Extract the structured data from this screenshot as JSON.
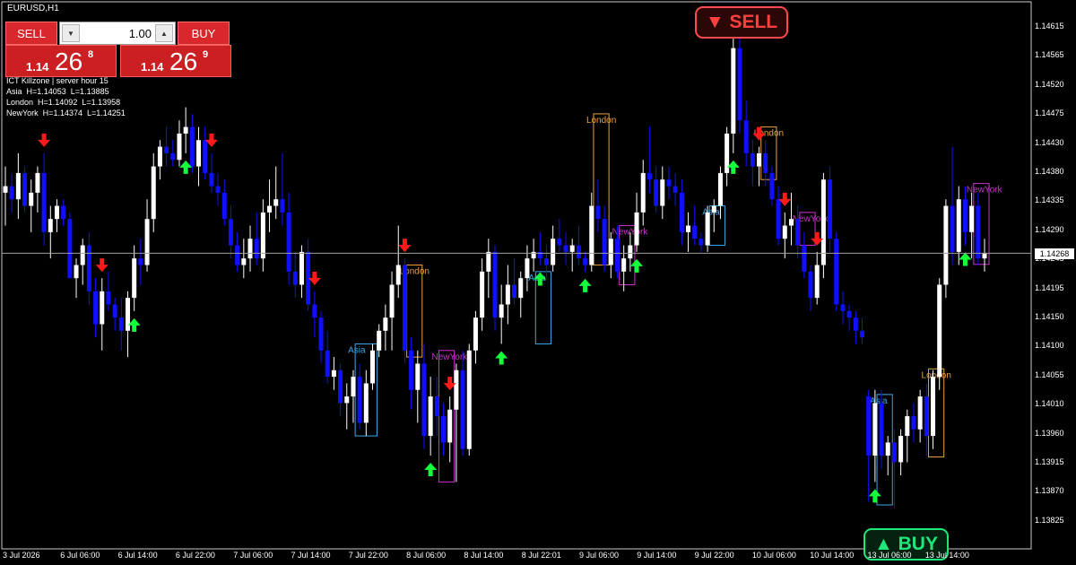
{
  "window": {
    "symbol_label": "EURUSD,H1"
  },
  "trade_panel": {
    "sell_label": "SELL",
    "buy_label": "BUY",
    "lot_value": "1.00",
    "sell_quote": {
      "prefix": "1.14",
      "big": "26",
      "sup": "8"
    },
    "buy_quote": {
      "prefix": "1.14",
      "big": "26",
      "sup": "9"
    }
  },
  "killzone_info": {
    "line1": "ICT Killzone | server hour 15",
    "line2": "Asia  H=1.14053  L=1.13885",
    "line3": "London  H=1.14092  L=1.13958",
    "line4": "NewYork  H=1.14374  L=1.14251"
  },
  "signals": {
    "sell_label": "▼ SELL",
    "buy_label": "▲ BUY"
  },
  "price_axis": {
    "labels": [
      "1.14615",
      "1.14565",
      "1.14520",
      "1.14475",
      "1.14430",
      "1.14380",
      "1.14335",
      "1.14290",
      "1.14245",
      "1.14195",
      "1.14150",
      "1.14100",
      "1.14055",
      "1.14010",
      "1.13960",
      "1.13915",
      "1.13870",
      "1.13825"
    ],
    "current_price": "1.14268"
  },
  "time_axis": {
    "labels": [
      "3 Jul 2026",
      "6 Jul 06:00",
      "6 Jul 14:00",
      "6 Jul 22:00",
      "7 Jul 06:00",
      "7 Jul 14:00",
      "7 Jul 22:00",
      "8 Jul 06:00",
      "8 Jul 14:00",
      "8 Jul 22:01",
      "9 Jul 06:00",
      "9 Jul 14:00",
      "9 Jul 22:00",
      "10 Jul 06:00",
      "10 Jul 14:00",
      "13 Jul 06:00",
      "13 Jul 14:00"
    ]
  },
  "colors": {
    "bull": "#ffffff",
    "bear": "#1010ff",
    "sell_arrow": "#ff1a1a",
    "buy_arrow": "#14ff3c",
    "asia": "#3aa7e8",
    "london": "#e8a040",
    "newyork": "#cc33cc"
  },
  "session_labels": {
    "asia": "Asia",
    "london": "London",
    "newyork": "NewYork"
  },
  "chart_data": {
    "type": "candlestick",
    "symbol": "EURUSD",
    "timeframe": "H1",
    "ylim": [
      1.13825,
      1.14615
    ],
    "current_price": 1.14268,
    "candles": [
      {
        "o": 1.1436,
        "h": 1.144,
        "l": 1.1431,
        "c": 1.1437
      },
      {
        "o": 1.1437,
        "h": 1.1439,
        "l": 1.1433,
        "c": 1.1435
      },
      {
        "o": 1.1435,
        "h": 1.1442,
        "l": 1.1432,
        "c": 1.1439
      },
      {
        "o": 1.1439,
        "h": 1.144,
        "l": 1.1433,
        "c": 1.1434
      },
      {
        "o": 1.1434,
        "h": 1.1438,
        "l": 1.143,
        "c": 1.1436
      },
      {
        "o": 1.1436,
        "h": 1.144,
        "l": 1.1433,
        "c": 1.1439
      },
      {
        "o": 1.1439,
        "h": 1.1442,
        "l": 1.1428,
        "c": 1.143
      },
      {
        "o": 1.143,
        "h": 1.1434,
        "l": 1.1426,
        "c": 1.1432
      },
      {
        "o": 1.1432,
        "h": 1.1435,
        "l": 1.143,
        "c": 1.1434
      },
      {
        "o": 1.1434,
        "h": 1.1435,
        "l": 1.1431,
        "c": 1.1432
      },
      {
        "o": 1.1432,
        "h": 1.1433,
        "l": 1.1426,
        "c": 1.1423
      },
      {
        "o": 1.1423,
        "h": 1.1426,
        "l": 1.142,
        "c": 1.1425
      },
      {
        "o": 1.1425,
        "h": 1.1429,
        "l": 1.1422,
        "c": 1.1428
      },
      {
        "o": 1.1428,
        "h": 1.143,
        "l": 1.1419,
        "c": 1.1421
      },
      {
        "o": 1.1421,
        "h": 1.1423,
        "l": 1.1414,
        "c": 1.1416
      },
      {
        "o": 1.1416,
        "h": 1.1423,
        "l": 1.1412,
        "c": 1.1421
      },
      {
        "o": 1.1421,
        "h": 1.1424,
        "l": 1.1418,
        "c": 1.1419
      },
      {
        "o": 1.1419,
        "h": 1.142,
        "l": 1.1415,
        "c": 1.1417
      },
      {
        "o": 1.1417,
        "h": 1.142,
        "l": 1.1412,
        "c": 1.1415
      },
      {
        "o": 1.1415,
        "h": 1.1421,
        "l": 1.1411,
        "c": 1.142
      },
      {
        "o": 1.142,
        "h": 1.1428,
        "l": 1.1418,
        "c": 1.1426
      },
      {
        "o": 1.1426,
        "h": 1.1429,
        "l": 1.1422,
        "c": 1.1425
      },
      {
        "o": 1.1425,
        "h": 1.1435,
        "l": 1.1424,
        "c": 1.1432
      },
      {
        "o": 1.1432,
        "h": 1.1442,
        "l": 1.143,
        "c": 1.144
      },
      {
        "o": 1.144,
        "h": 1.1444,
        "l": 1.1438,
        "c": 1.1443
      },
      {
        "o": 1.1443,
        "h": 1.1446,
        "l": 1.144,
        "c": 1.1442
      },
      {
        "o": 1.1442,
        "h": 1.1444,
        "l": 1.144,
        "c": 1.1441
      },
      {
        "o": 1.1441,
        "h": 1.1447,
        "l": 1.144,
        "c": 1.1445
      },
      {
        "o": 1.1445,
        "h": 1.1449,
        "l": 1.1442,
        "c": 1.1446
      },
      {
        "o": 1.1446,
        "h": 1.1448,
        "l": 1.1439,
        "c": 1.144
      },
      {
        "o": 1.144,
        "h": 1.1446,
        "l": 1.1437,
        "c": 1.1444
      },
      {
        "o": 1.1444,
        "h": 1.1446,
        "l": 1.1438,
        "c": 1.1439
      },
      {
        "o": 1.1439,
        "h": 1.1442,
        "l": 1.1436,
        "c": 1.1437
      },
      {
        "o": 1.1437,
        "h": 1.1439,
        "l": 1.1434,
        "c": 1.1436
      },
      {
        "o": 1.1436,
        "h": 1.1438,
        "l": 1.1431,
        "c": 1.1432
      },
      {
        "o": 1.1432,
        "h": 1.1434,
        "l": 1.1426,
        "c": 1.1428
      },
      {
        "o": 1.1428,
        "h": 1.143,
        "l": 1.1424,
        "c": 1.1425
      },
      {
        "o": 1.1425,
        "h": 1.1429,
        "l": 1.1423,
        "c": 1.1426
      },
      {
        "o": 1.1426,
        "h": 1.1431,
        "l": 1.1424,
        "c": 1.1429
      },
      {
        "o": 1.1429,
        "h": 1.1433,
        "l": 1.1425,
        "c": 1.1426
      },
      {
        "o": 1.1426,
        "h": 1.1435,
        "l": 1.1424,
        "c": 1.1433
      },
      {
        "o": 1.1433,
        "h": 1.1438,
        "l": 1.143,
        "c": 1.1434
      },
      {
        "o": 1.1434,
        "h": 1.144,
        "l": 1.1432,
        "c": 1.1435
      },
      {
        "o": 1.1435,
        "h": 1.1442,
        "l": 1.1431,
        "c": 1.1433
      },
      {
        "o": 1.1433,
        "h": 1.1436,
        "l": 1.1422,
        "c": 1.1424
      },
      {
        "o": 1.1424,
        "h": 1.1427,
        "l": 1.142,
        "c": 1.1422
      },
      {
        "o": 1.1422,
        "h": 1.1428,
        "l": 1.142,
        "c": 1.1427
      },
      {
        "o": 1.1427,
        "h": 1.1429,
        "l": 1.1418,
        "c": 1.1419
      },
      {
        "o": 1.1419,
        "h": 1.1421,
        "l": 1.1414,
        "c": 1.1417
      },
      {
        "o": 1.1417,
        "h": 1.1418,
        "l": 1.141,
        "c": 1.1412
      },
      {
        "o": 1.1412,
        "h": 1.1415,
        "l": 1.1407,
        "c": 1.1408
      },
      {
        "o": 1.1408,
        "h": 1.1411,
        "l": 1.1406,
        "c": 1.1409
      },
      {
        "o": 1.1409,
        "h": 1.141,
        "l": 1.1402,
        "c": 1.1404
      },
      {
        "o": 1.1404,
        "h": 1.1407,
        "l": 1.14,
        "c": 1.1405
      },
      {
        "o": 1.1405,
        "h": 1.1409,
        "l": 1.1401,
        "c": 1.1408
      },
      {
        "o": 1.1408,
        "h": 1.141,
        "l": 1.14,
        "c": 1.1401
      },
      {
        "o": 1.1401,
        "h": 1.1409,
        "l": 1.1399,
        "c": 1.1407
      },
      {
        "o": 1.1407,
        "h": 1.1413,
        "l": 1.1406,
        "c": 1.1412
      },
      {
        "o": 1.1412,
        "h": 1.1416,
        "l": 1.1411,
        "c": 1.1415
      },
      {
        "o": 1.1415,
        "h": 1.1419,
        "l": 1.1412,
        "c": 1.1417
      },
      {
        "o": 1.1417,
        "h": 1.1424,
        "l": 1.1412,
        "c": 1.1422
      },
      {
        "o": 1.1422,
        "h": 1.1431,
        "l": 1.142,
        "c": 1.1425
      },
      {
        "o": 1.1425,
        "h": 1.1426,
        "l": 1.141,
        "c": 1.1412
      },
      {
        "o": 1.1412,
        "h": 1.1414,
        "l": 1.1403,
        "c": 1.1406
      },
      {
        "o": 1.1406,
        "h": 1.1412,
        "l": 1.1401,
        "c": 1.141
      },
      {
        "o": 1.141,
        "h": 1.1413,
        "l": 1.1397,
        "c": 1.1399
      },
      {
        "o": 1.1399,
        "h": 1.1408,
        "l": 1.1396,
        "c": 1.1405
      },
      {
        "o": 1.1405,
        "h": 1.1408,
        "l": 1.1399,
        "c": 1.1402
      },
      {
        "o": 1.1402,
        "h": 1.1404,
        "l": 1.1396,
        "c": 1.1398
      },
      {
        "o": 1.1398,
        "h": 1.1405,
        "l": 1.1395,
        "c": 1.1403
      },
      {
        "o": 1.1403,
        "h": 1.141,
        "l": 1.1392,
        "c": 1.1409
      },
      {
        "o": 1.1409,
        "h": 1.1412,
        "l": 1.1396,
        "c": 1.1397
      },
      {
        "o": 1.1397,
        "h": 1.1413,
        "l": 1.1396,
        "c": 1.1412
      },
      {
        "o": 1.1412,
        "h": 1.1418,
        "l": 1.141,
        "c": 1.1417
      },
      {
        "o": 1.1417,
        "h": 1.1426,
        "l": 1.1415,
        "c": 1.1424
      },
      {
        "o": 1.1424,
        "h": 1.1429,
        "l": 1.142,
        "c": 1.1427
      },
      {
        "o": 1.1427,
        "h": 1.1428,
        "l": 1.1415,
        "c": 1.1417
      },
      {
        "o": 1.1417,
        "h": 1.1422,
        "l": 1.1413,
        "c": 1.1419
      },
      {
        "o": 1.1419,
        "h": 1.1425,
        "l": 1.1416,
        "c": 1.1422
      },
      {
        "o": 1.1422,
        "h": 1.1426,
        "l": 1.1419,
        "c": 1.142
      },
      {
        "o": 1.142,
        "h": 1.1424,
        "l": 1.1417,
        "c": 1.1423
      },
      {
        "o": 1.1423,
        "h": 1.1428,
        "l": 1.1421,
        "c": 1.1426
      },
      {
        "o": 1.1426,
        "h": 1.1429,
        "l": 1.1424,
        "c": 1.1427
      },
      {
        "o": 1.1427,
        "h": 1.143,
        "l": 1.1425,
        "c": 1.1426
      },
      {
        "o": 1.1426,
        "h": 1.1428,
        "l": 1.1423,
        "c": 1.1425
      },
      {
        "o": 1.1425,
        "h": 1.1431,
        "l": 1.1424,
        "c": 1.1429
      },
      {
        "o": 1.1429,
        "h": 1.1432,
        "l": 1.1427,
        "c": 1.1428
      },
      {
        "o": 1.1428,
        "h": 1.143,
        "l": 1.1425,
        "c": 1.1427
      },
      {
        "o": 1.1427,
        "h": 1.1429,
        "l": 1.1424,
        "c": 1.1428
      },
      {
        "o": 1.1428,
        "h": 1.1431,
        "l": 1.1425,
        "c": 1.1426
      },
      {
        "o": 1.1426,
        "h": 1.1427,
        "l": 1.1424,
        "c": 1.1425
      },
      {
        "o": 1.1425,
        "h": 1.1436,
        "l": 1.1424,
        "c": 1.1434
      },
      {
        "o": 1.1434,
        "h": 1.1438,
        "l": 1.143,
        "c": 1.1432
      },
      {
        "o": 1.1432,
        "h": 1.1434,
        "l": 1.1424,
        "c": 1.1425
      },
      {
        "o": 1.1425,
        "h": 1.143,
        "l": 1.1423,
        "c": 1.1429
      },
      {
        "o": 1.1429,
        "h": 1.1431,
        "l": 1.1423,
        "c": 1.1424
      },
      {
        "o": 1.1424,
        "h": 1.1428,
        "l": 1.1421,
        "c": 1.1426
      },
      {
        "o": 1.1426,
        "h": 1.143,
        "l": 1.1424,
        "c": 1.1428
      },
      {
        "o": 1.1428,
        "h": 1.1436,
        "l": 1.1427,
        "c": 1.1433
      },
      {
        "o": 1.1433,
        "h": 1.1441,
        "l": 1.1431,
        "c": 1.1439
      },
      {
        "o": 1.1439,
        "h": 1.1446,
        "l": 1.1436,
        "c": 1.1438
      },
      {
        "o": 1.1438,
        "h": 1.144,
        "l": 1.1433,
        "c": 1.1434
      },
      {
        "o": 1.1434,
        "h": 1.144,
        "l": 1.1432,
        "c": 1.1438
      },
      {
        "o": 1.1438,
        "h": 1.144,
        "l": 1.1435,
        "c": 1.1437
      },
      {
        "o": 1.1437,
        "h": 1.1439,
        "l": 1.1434,
        "c": 1.1436
      },
      {
        "o": 1.1436,
        "h": 1.1438,
        "l": 1.1428,
        "c": 1.143
      },
      {
        "o": 1.143,
        "h": 1.1433,
        "l": 1.1427,
        "c": 1.1431
      },
      {
        "o": 1.1431,
        "h": 1.1434,
        "l": 1.1428,
        "c": 1.1429
      },
      {
        "o": 1.1429,
        "h": 1.143,
        "l": 1.1427,
        "c": 1.1428
      },
      {
        "o": 1.1428,
        "h": 1.1434,
        "l": 1.1427,
        "c": 1.1433
      },
      {
        "o": 1.1433,
        "h": 1.1435,
        "l": 1.143,
        "c": 1.1434
      },
      {
        "o": 1.1434,
        "h": 1.144,
        "l": 1.1432,
        "c": 1.1439
      },
      {
        "o": 1.1439,
        "h": 1.1446,
        "l": 1.1437,
        "c": 1.1445
      },
      {
        "o": 1.1445,
        "h": 1.146,
        "l": 1.1442,
        "c": 1.1458
      },
      {
        "o": 1.1458,
        "h": 1.146,
        "l": 1.1445,
        "c": 1.1447
      },
      {
        "o": 1.1447,
        "h": 1.145,
        "l": 1.144,
        "c": 1.1442
      },
      {
        "o": 1.1442,
        "h": 1.1444,
        "l": 1.1437,
        "c": 1.144
      },
      {
        "o": 1.144,
        "h": 1.1443,
        "l": 1.1437,
        "c": 1.1442
      },
      {
        "o": 1.1442,
        "h": 1.1444,
        "l": 1.1437,
        "c": 1.1439
      },
      {
        "o": 1.1439,
        "h": 1.144,
        "l": 1.1434,
        "c": 1.1435
      },
      {
        "o": 1.1435,
        "h": 1.1437,
        "l": 1.1428,
        "c": 1.1429
      },
      {
        "o": 1.1429,
        "h": 1.1433,
        "l": 1.1426,
        "c": 1.1431
      },
      {
        "o": 1.1431,
        "h": 1.1436,
        "l": 1.1428,
        "c": 1.1432
      },
      {
        "o": 1.1432,
        "h": 1.1434,
        "l": 1.1426,
        "c": 1.1428
      },
      {
        "o": 1.1428,
        "h": 1.143,
        "l": 1.1423,
        "c": 1.1424
      },
      {
        "o": 1.1424,
        "h": 1.1425,
        "l": 1.1418,
        "c": 1.142
      },
      {
        "o": 1.142,
        "h": 1.1427,
        "l": 1.1419,
        "c": 1.1425
      },
      {
        "o": 1.1425,
        "h": 1.1439,
        "l": 1.1423,
        "c": 1.1438
      },
      {
        "o": 1.1438,
        "h": 1.144,
        "l": 1.1427,
        "c": 1.1429
      },
      {
        "o": 1.1429,
        "h": 1.143,
        "l": 1.1418,
        "c": 1.1419
      },
      {
        "o": 1.1419,
        "h": 1.1421,
        "l": 1.1416,
        "c": 1.1418
      },
      {
        "o": 1.1418,
        "h": 1.1419,
        "l": 1.1415,
        "c": 1.1417
      },
      {
        "o": 1.1417,
        "h": 1.1418,
        "l": 1.1413,
        "c": 1.1415
      },
      {
        "o": 1.1415,
        "h": 1.1417,
        "l": 1.1413,
        "c": 1.1414
      },
      {
        "o": 1.1405,
        "h": 1.1406,
        "l": 1.1389,
        "c": 1.1396
      },
      {
        "o": 1.1396,
        "h": 1.1406,
        "l": 1.1392,
        "c": 1.1404
      },
      {
        "o": 1.1404,
        "h": 1.1406,
        "l": 1.1394,
        "c": 1.1396
      },
      {
        "o": 1.1396,
        "h": 1.1399,
        "l": 1.1393,
        "c": 1.1398
      },
      {
        "o": 1.1398,
        "h": 1.14,
        "l": 1.1388,
        "c": 1.1395
      },
      {
        "o": 1.1395,
        "h": 1.14,
        "l": 1.1393,
        "c": 1.1399
      },
      {
        "o": 1.1399,
        "h": 1.1403,
        "l": 1.1395,
        "c": 1.1402
      },
      {
        "o": 1.1402,
        "h": 1.1404,
        "l": 1.1398,
        "c": 1.14
      },
      {
        "o": 1.14,
        "h": 1.1406,
        "l": 1.1398,
        "c": 1.1405
      },
      {
        "o": 1.1405,
        "h": 1.1407,
        "l": 1.1396,
        "c": 1.1399
      },
      {
        "o": 1.1399,
        "h": 1.1409,
        "l": 1.1397,
        "c": 1.1408
      },
      {
        "o": 1.1408,
        "h": 1.1423,
        "l": 1.1406,
        "c": 1.1422
      },
      {
        "o": 1.1422,
        "h": 1.1435,
        "l": 1.142,
        "c": 1.1434
      },
      {
        "o": 1.1434,
        "h": 1.1443,
        "l": 1.1425,
        "c": 1.1427
      },
      {
        "o": 1.1427,
        "h": 1.1437,
        "l": 1.1425,
        "c": 1.1435
      },
      {
        "o": 1.1435,
        "h": 1.1437,
        "l": 1.1428,
        "c": 1.143
      },
      {
        "o": 1.143,
        "h": 1.1436,
        "l": 1.1426,
        "c": 1.1434
      },
      {
        "o": 1.1434,
        "h": 1.1436,
        "l": 1.1425,
        "c": 1.1426
      },
      {
        "o": 1.1426,
        "h": 1.1429,
        "l": 1.1424,
        "c": 1.14268
      }
    ],
    "sell_signals_candle_index": [
      6,
      15,
      32,
      48,
      62,
      69,
      117,
      121,
      126
    ],
    "buy_signals_candle_index": [
      20,
      28,
      66,
      77,
      83,
      90,
      98,
      113,
      135,
      149
    ],
    "sessions": [
      {
        "name": "Asia",
        "start": 55,
        "end": 57,
        "high": 1.1413,
        "low": 1.1399
      },
      {
        "name": "London",
        "start": 63,
        "end": 64,
        "high": 1.1425,
        "low": 1.1411
      },
      {
        "name": "NewYork",
        "start": 68,
        "end": 69,
        "high": 1.1412,
        "low": 1.1392
      },
      {
        "name": "Asia",
        "start": 83,
        "end": 84,
        "high": 1.1424,
        "low": 1.1413
      },
      {
        "name": "London",
        "start": 92,
        "end": 93,
        "high": 1.1448,
        "low": 1.1425
      },
      {
        "name": "NewYork",
        "start": 96,
        "end": 97,
        "high": 1.1431,
        "low": 1.1422
      },
      {
        "name": "Asia",
        "start": 110,
        "end": 111,
        "high": 1.1434,
        "low": 1.1428
      },
      {
        "name": "London",
        "start": 118,
        "end": 119,
        "high": 1.1446,
        "low": 1.1438
      },
      {
        "name": "NewYork",
        "start": 124,
        "end": 125,
        "high": 1.1433,
        "low": 1.1428
      },
      {
        "name": "Asia",
        "start": 136,
        "end": 137,
        "high": 1.14053,
        "low": 1.13885
      },
      {
        "name": "London",
        "start": 144,
        "end": 145,
        "high": 1.14092,
        "low": 1.13958
      },
      {
        "name": "NewYork",
        "start": 151,
        "end": 152,
        "high": 1.14374,
        "low": 1.14251
      }
    ]
  }
}
